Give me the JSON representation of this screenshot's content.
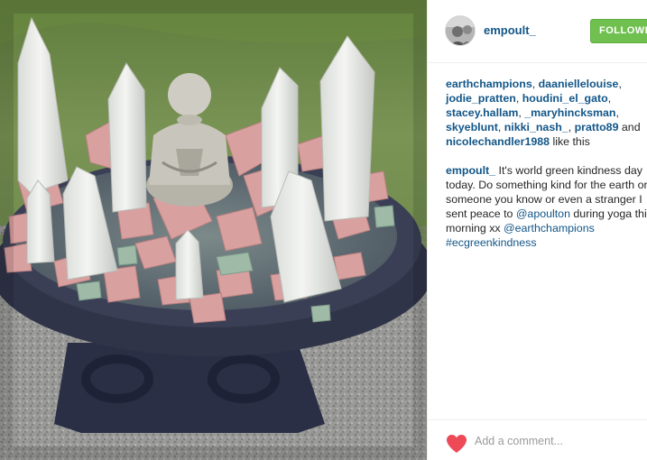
{
  "post": {
    "image_alt_icon": "photo-crystal-buddha-birdbath"
  },
  "author": {
    "username": "empoult_",
    "avatar_icon": "avatar-photo-icon"
  },
  "follow_button": {
    "label": "FOLLOWING"
  },
  "likes": {
    "users": [
      "earthchampions",
      "daaniellelouise",
      "jodie_pratten",
      "houdini_el_gato",
      "stacey.hallam",
      "_maryhincksman",
      "skyeblunt",
      "nikki_nash_",
      "pratto89",
      "nicolechandler1988"
    ],
    "sep": ", ",
    "and_word": " and",
    "suffix": " like this"
  },
  "caption": {
    "username": "empoult_",
    "line1": " It's world green kindness day",
    "line2": "today. Do something kind for the earth or",
    "line3": "someone you know or even a stranger I",
    "line4a": "sent peace to ",
    "mention1": "@apoulton",
    "line4b": " during yoga this",
    "line5a": "morning xx ",
    "mention2": "@earthchampions",
    "hashtag": "#ecgreenkindness"
  },
  "comment": {
    "placeholder": "Add a comment..."
  },
  "colors": {
    "link": "#125688",
    "follow_green": "#70c050",
    "heart_red": "#ed4956"
  }
}
